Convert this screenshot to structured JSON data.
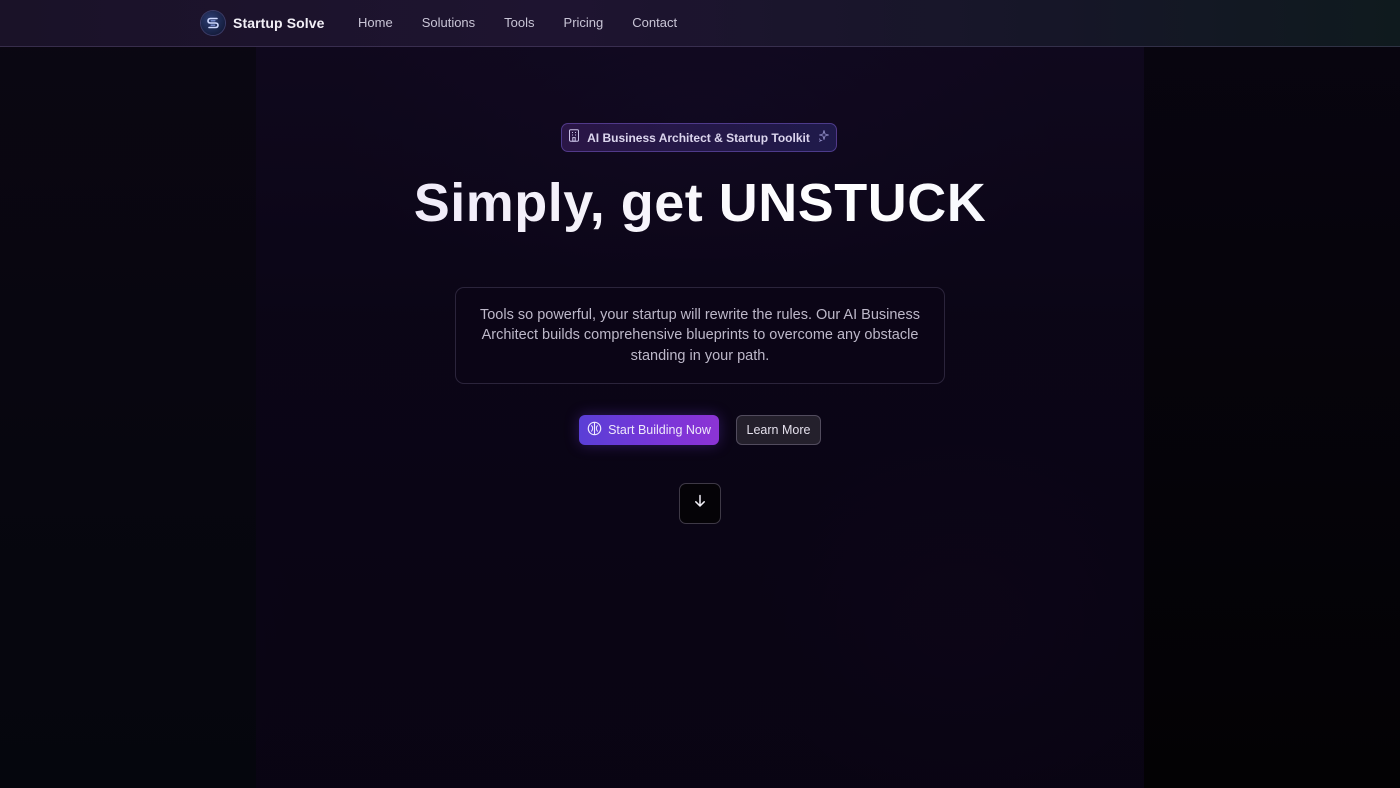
{
  "brand": {
    "name": "Startup Solve",
    "logo_icon": "s-logo-icon"
  },
  "nav": {
    "items": [
      {
        "label": "Home"
      },
      {
        "label": "Solutions"
      },
      {
        "label": "Tools"
      },
      {
        "label": "Pricing"
      },
      {
        "label": "Contact"
      }
    ]
  },
  "hero": {
    "badge": {
      "text": "AI Business Architect & Startup Toolkit",
      "leading_icon": "building-icon",
      "trailing_icon": "sparkles-icon"
    },
    "title": "Simply, get UNSTUCK",
    "description": "Tools so powerful, your startup will rewrite the rules. Our AI Business Architect builds comprehensive blueprints to overcome any obstacle standing in your path.",
    "primary_button": {
      "label": "Start Building Now",
      "icon": "brain-icon"
    },
    "secondary_button": {
      "label": "Learn More"
    },
    "scroll_button": {
      "icon": "arrow-down-icon"
    }
  },
  "colors": {
    "background": "#050208",
    "accent_start": "#5a3fd6",
    "accent_end": "#8c34d4",
    "text_primary": "#f2f0f7",
    "text_muted": "#bdb8c9"
  }
}
